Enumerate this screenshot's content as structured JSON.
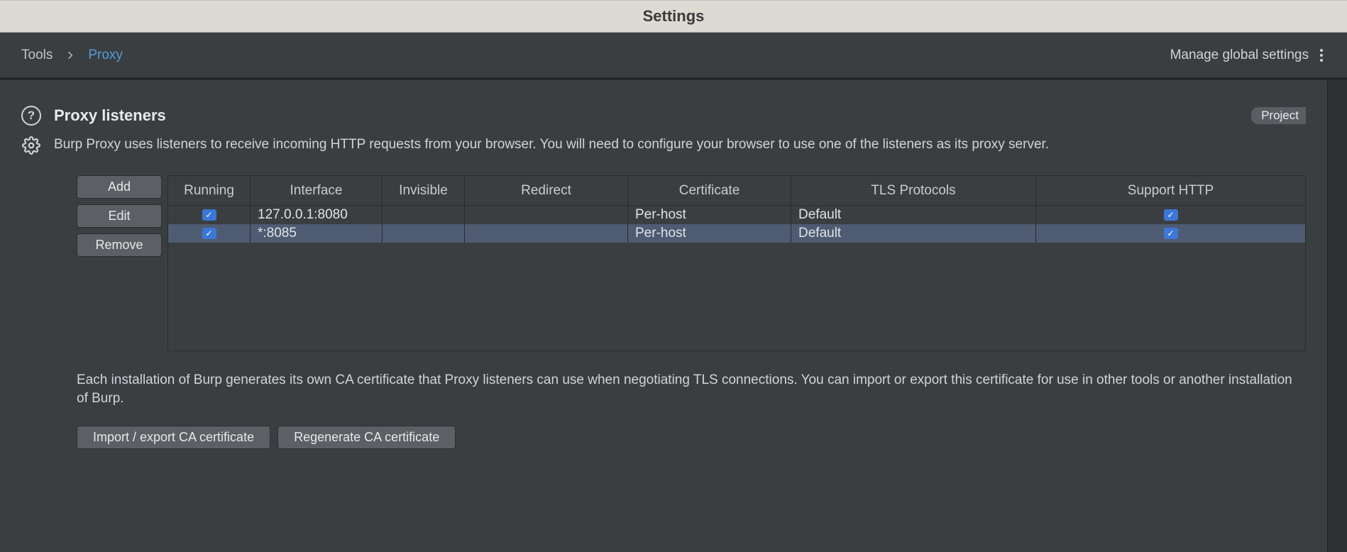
{
  "window": {
    "title": "Settings"
  },
  "breadcrumb": {
    "root": "Tools",
    "current": "Proxy",
    "manage": "Manage global settings"
  },
  "section": {
    "title": "Proxy listeners",
    "scope_badge": "Project",
    "description": "Burp Proxy uses listeners to receive incoming HTTP requests from your browser. You will need to configure your browser to use one of the listeners as its proxy server."
  },
  "buttons": {
    "add": "Add",
    "edit": "Edit",
    "remove": "Remove",
    "import_export": "Import / export CA certificate",
    "regenerate": "Regenerate CA certificate"
  },
  "table": {
    "headers": {
      "running": "Running",
      "interface": "Interface",
      "invisible": "Invisible",
      "redirect": "Redirect",
      "certificate": "Certificate",
      "tls": "TLS Protocols",
      "support": "Support HTTP"
    },
    "rows": [
      {
        "running": true,
        "interface": "127.0.0.1:8080",
        "invisible": "",
        "redirect": "",
        "certificate": "Per-host",
        "tls": "Default",
        "support": true,
        "selected": false
      },
      {
        "running": true,
        "interface": "*:8085",
        "invisible": "",
        "redirect": "",
        "certificate": "Per-host",
        "tls": "Default",
        "support": true,
        "selected": true
      }
    ]
  },
  "ca": {
    "description": "Each installation of Burp generates its own CA certificate that Proxy listeners can use when negotiating TLS connections. You can import or export this certificate for use in other tools or another installation of Burp."
  }
}
